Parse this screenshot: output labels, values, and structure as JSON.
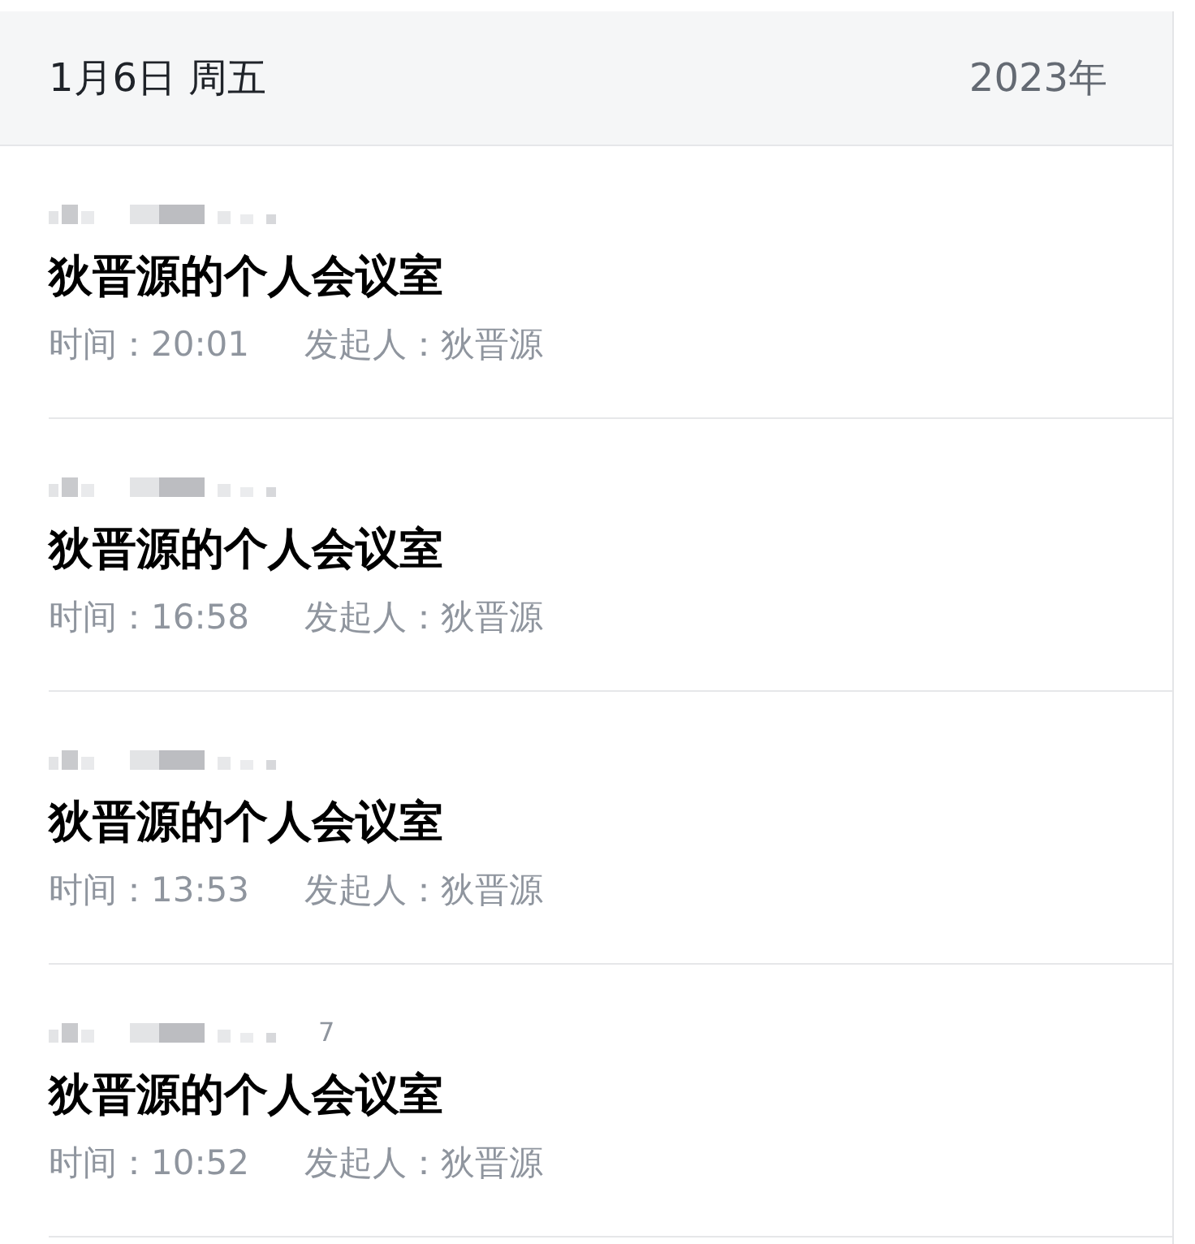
{
  "header": {
    "date": "1月6日 周五",
    "year": "2023年"
  },
  "meetings": [
    {
      "title": "狄晋源的个人会议室",
      "time_label": "时间：",
      "time": "20:01",
      "host_label": "发起人：",
      "host": "狄晋源"
    },
    {
      "title": "狄晋源的个人会议室",
      "time_label": "时间：",
      "time": "16:58",
      "host_label": "发起人：",
      "host": "狄晋源"
    },
    {
      "title": "狄晋源的个人会议室",
      "time_label": "时间：",
      "time": "13:53",
      "host_label": "发起人：",
      "host": "狄晋源"
    },
    {
      "title": "狄晋源的个人会议室",
      "time_label": "时间：",
      "time": "10:52",
      "host_label": "发起人：",
      "host": "狄晋源",
      "id_tail": "7"
    }
  ]
}
